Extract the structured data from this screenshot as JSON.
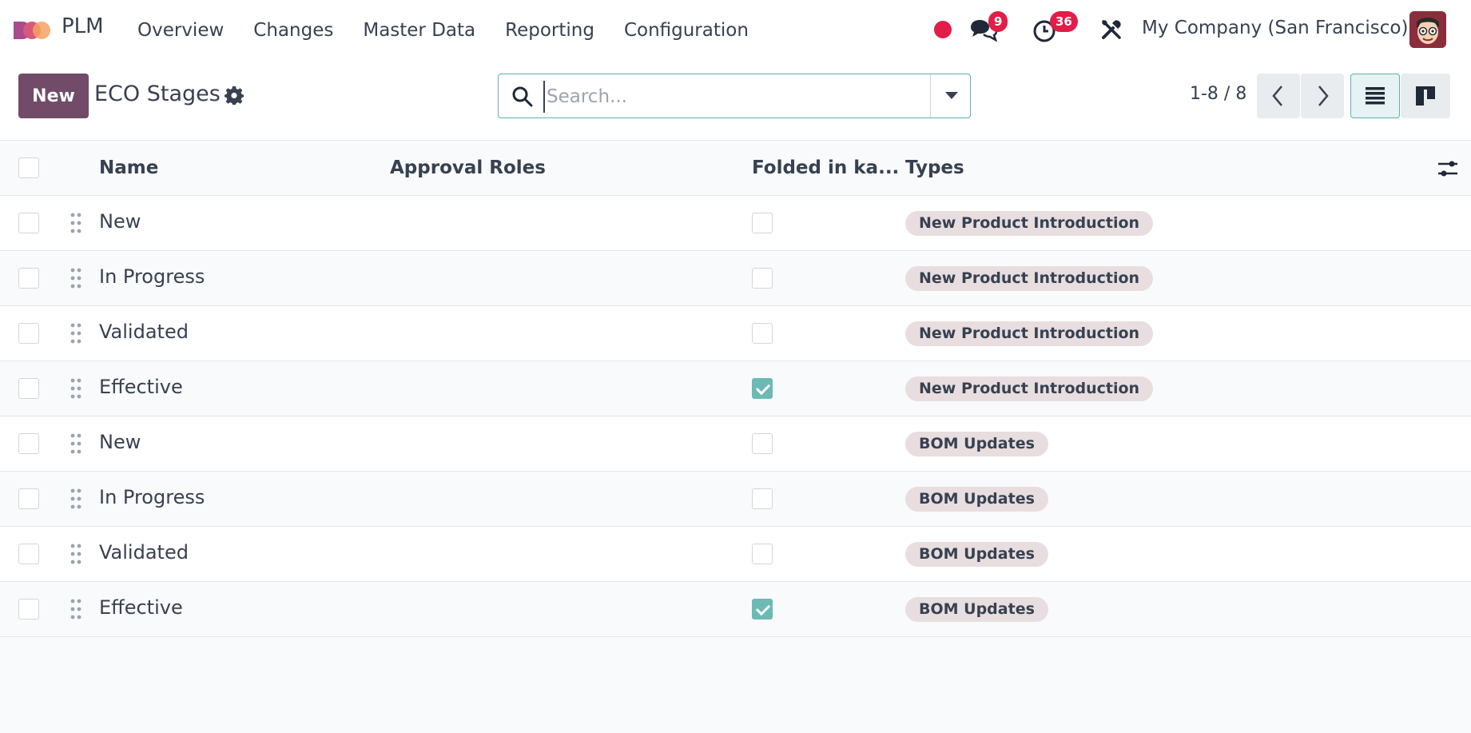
{
  "navbar": {
    "app_name": "PLM",
    "menu": [
      "Overview",
      "Changes",
      "Master Data",
      "Reporting",
      "Configuration"
    ],
    "messages_count": "9",
    "activities_count": "36",
    "company": "My Company (San Francisco)",
    "recording_color": "#e11d48"
  },
  "control": {
    "new_label": "New",
    "title": "ECO Stages",
    "search_placeholder": "Search...",
    "pager": "1-8 / 8"
  },
  "table": {
    "headers": {
      "name": "Name",
      "approval_roles": "Approval Roles",
      "folded": "Folded in ka...",
      "types": "Types"
    },
    "rows": [
      {
        "name": "New",
        "approval_roles": "",
        "folded": false,
        "type": "New Product Introduction"
      },
      {
        "name": "In Progress",
        "approval_roles": "",
        "folded": false,
        "type": "New Product Introduction"
      },
      {
        "name": "Validated",
        "approval_roles": "",
        "folded": false,
        "type": "New Product Introduction"
      },
      {
        "name": "Effective",
        "approval_roles": "",
        "folded": true,
        "type": "New Product Introduction"
      },
      {
        "name": "New",
        "approval_roles": "",
        "folded": false,
        "type": "BOM Updates"
      },
      {
        "name": "In Progress",
        "approval_roles": "",
        "folded": false,
        "type": "BOM Updates"
      },
      {
        "name": "Validated",
        "approval_roles": "",
        "folded": false,
        "type": "BOM Updates"
      },
      {
        "name": "Effective",
        "approval_roles": "",
        "folded": true,
        "type": "BOM Updates"
      }
    ]
  },
  "colors": {
    "primary": "#714b67",
    "accent": "#6bbab5",
    "tag_bg": "#e8dedf",
    "badge": "#e11d48"
  }
}
